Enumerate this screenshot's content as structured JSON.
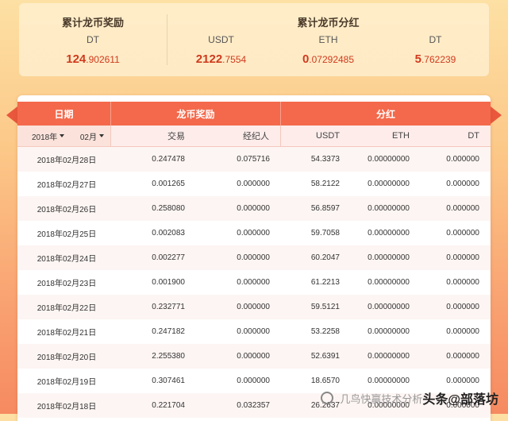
{
  "summary": {
    "reward": {
      "title": "累计龙币奖励",
      "label": "DT",
      "value_int": "124",
      "value_dec": ".902611"
    },
    "dividend": {
      "title": "累计龙币分红",
      "items": [
        {
          "label": "USDT",
          "value_int": "2122",
          "value_dec": ".7554"
        },
        {
          "label": "ETH",
          "value_int": "0",
          "value_dec": ".07292485"
        },
        {
          "label": "DT",
          "value_int": "5",
          "value_dec": ".762239"
        }
      ]
    }
  },
  "table": {
    "header": {
      "date": "日期",
      "reward": "龙币奖励",
      "dividend": "分红"
    },
    "filters": {
      "year": "2018年",
      "month": "02月"
    },
    "subheader": {
      "trade": "交易",
      "agent": "经纪人",
      "usdt": "USDT",
      "eth": "ETH",
      "dt": "DT"
    },
    "rows": [
      {
        "date": "2018年02月28日",
        "trade": "0.247478",
        "agent": "0.075716",
        "usdt": "54.3373",
        "eth": "0.00000000",
        "dt": "0.000000"
      },
      {
        "date": "2018年02月27日",
        "trade": "0.001265",
        "agent": "0.000000",
        "usdt": "58.2122",
        "eth": "0.00000000",
        "dt": "0.000000"
      },
      {
        "date": "2018年02月26日",
        "trade": "0.258080",
        "agent": "0.000000",
        "usdt": "56.8597",
        "eth": "0.00000000",
        "dt": "0.000000"
      },
      {
        "date": "2018年02月25日",
        "trade": "0.002083",
        "agent": "0.000000",
        "usdt": "59.7058",
        "eth": "0.00000000",
        "dt": "0.000000"
      },
      {
        "date": "2018年02月24日",
        "trade": "0.002277",
        "agent": "0.000000",
        "usdt": "60.2047",
        "eth": "0.00000000",
        "dt": "0.000000"
      },
      {
        "date": "2018年02月23日",
        "trade": "0.001900",
        "agent": "0.000000",
        "usdt": "61.2213",
        "eth": "0.00000000",
        "dt": "0.000000"
      },
      {
        "date": "2018年02月22日",
        "trade": "0.232771",
        "agent": "0.000000",
        "usdt": "59.5121",
        "eth": "0.00000000",
        "dt": "0.000000"
      },
      {
        "date": "2018年02月21日",
        "trade": "0.247182",
        "agent": "0.000000",
        "usdt": "53.2258",
        "eth": "0.00000000",
        "dt": "0.000000"
      },
      {
        "date": "2018年02月20日",
        "trade": "2.255380",
        "agent": "0.000000",
        "usdt": "52.6391",
        "eth": "0.00000000",
        "dt": "0.000000"
      },
      {
        "date": "2018年02月19日",
        "trade": "0.307461",
        "agent": "0.000000",
        "usdt": "18.6570",
        "eth": "0.00000000",
        "dt": "0.000000"
      },
      {
        "date": "2018年02月18日",
        "trade": "0.221704",
        "agent": "0.032357",
        "usdt": "26.2637",
        "eth": "0.00000000",
        "dt": "0.000000"
      }
    ]
  },
  "watermark": {
    "brand": "头条",
    "handle": "@部落坊",
    "faint_text": "几鸟快赢技术分析"
  },
  "colors": {
    "header_red": "#f4694b",
    "value_red": "#d03a1e"
  }
}
